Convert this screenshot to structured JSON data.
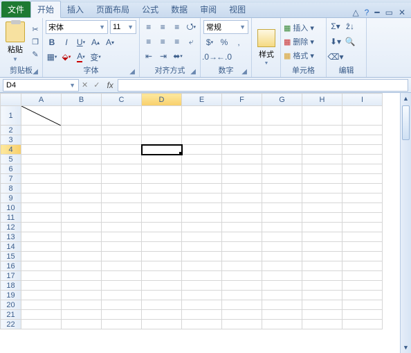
{
  "tabs": {
    "file": "文件",
    "home": "开始",
    "insert": "插入",
    "layout": "页面布局",
    "formulas": "公式",
    "data": "数据",
    "review": "审阅",
    "view": "视图"
  },
  "ribbon": {
    "clipboard": {
      "paste": "粘贴",
      "label": "剪贴板"
    },
    "font": {
      "name": "宋体",
      "size": "11",
      "label": "字体"
    },
    "align": {
      "label": "对齐方式"
    },
    "number": {
      "format": "常规",
      "label": "数字"
    },
    "styles": {
      "btn": "样式"
    },
    "cells": {
      "insert": "插入",
      "delete": "删除",
      "format": "格式",
      "label": "单元格"
    },
    "editing": {
      "label": "编辑"
    }
  },
  "namebox": {
    "value": "D4"
  },
  "columns": [
    "A",
    "B",
    "C",
    "D",
    "E",
    "F",
    "G",
    "H",
    "I"
  ],
  "rows": [
    "1",
    "2",
    "3",
    "4",
    "5",
    "6",
    "7",
    "8",
    "9",
    "10",
    "11",
    "12",
    "13",
    "14",
    "15",
    "16",
    "17",
    "18",
    "19",
    "20",
    "21",
    "22"
  ],
  "selection": {
    "col": "D",
    "row": "4"
  }
}
